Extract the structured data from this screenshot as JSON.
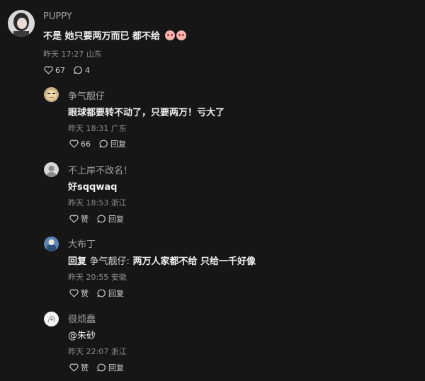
{
  "main_comment": {
    "username": "PUPPY",
    "text": "不是 她只要两万而已 都不给",
    "emoji_icons": [
      "red-face-emoji-icon",
      "red-face-emoji-icon"
    ],
    "time": "昨天 17:27",
    "location": "山东",
    "likes": "67",
    "replies": "4"
  },
  "replies": [
    {
      "username": "争气靓仔",
      "text": "眼球都要转不动了，只要两万！亏大了",
      "time": "昨天 18:31",
      "location": "广东",
      "like_label": "66",
      "reply_label": "回复"
    },
    {
      "username": "不上岸不改名！",
      "text": "好sqqwaq",
      "time": "昨天 18:53",
      "location": "浙江",
      "like_label": "赞",
      "reply_label": "回复"
    },
    {
      "username": "大布丁",
      "reply_prefix": "回复",
      "reply_to": "争气靓仔:",
      "text": "两万人家都不给 只给一千好像",
      "time": "昨天 20:55",
      "location": "安徽",
      "like_label": "赞",
      "reply_label": "回复"
    },
    {
      "username": "很烦蠢",
      "text": "@朱砂",
      "time": "昨天 22:07",
      "location": "浙江",
      "like_label": "赞",
      "reply_label": "回复"
    }
  ],
  "colors": {
    "background": "#161616",
    "primary_text": "#f1f1f1",
    "secondary_text": "#a3a3a3",
    "meta_text": "#8c8c8c"
  }
}
